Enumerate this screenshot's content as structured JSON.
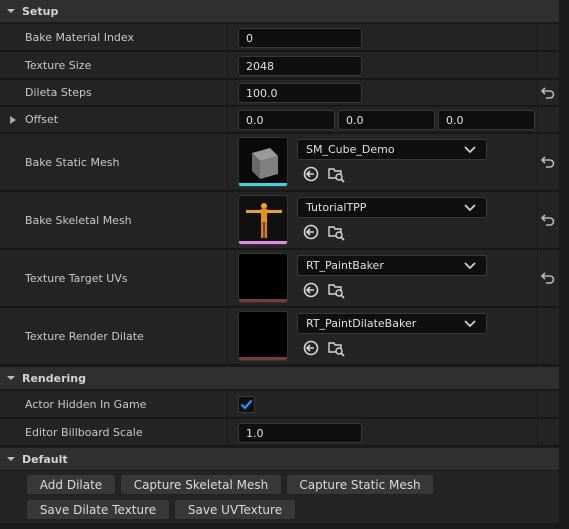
{
  "sections": {
    "setup": "Setup",
    "rendering": "Rendering",
    "default": "Default"
  },
  "setup": {
    "bake_material_index": {
      "label": "Bake Material Index",
      "value": "0"
    },
    "texture_size": {
      "label": "Texture Size",
      "value": "2048"
    },
    "dileta_steps": {
      "label": "Dileta Steps",
      "value": "100.0"
    },
    "offset": {
      "label": "Offset",
      "x": "0.0",
      "y": "0.0",
      "z": "0.0"
    },
    "bake_static_mesh": {
      "label": "Bake Static Mesh",
      "asset": "SM_Cube_Demo"
    },
    "bake_skeletal_mesh": {
      "label": "Bake Skeletal Mesh",
      "asset": "TutorialTPP"
    },
    "texture_target_uvs": {
      "label": "Texture Target UVs",
      "asset": "RT_PaintBaker"
    },
    "texture_render_dilate": {
      "label": "Texture Render Dilate",
      "asset": "RT_PaintDilateBaker"
    }
  },
  "rendering": {
    "actor_hidden_in_game": {
      "label": "Actor Hidden In Game",
      "checked": true
    },
    "editor_billboard_scale": {
      "label": "Editor Billboard Scale",
      "value": "1.0"
    }
  },
  "default": {
    "buttons": [
      "Add Dilate",
      "Capture Skeletal Mesh",
      "Capture Static Mesh",
      "Save Dilate Texture",
      "Save UVTexture"
    ]
  },
  "colors": {
    "static_mesh_bar": "#3fd6e0",
    "skeletal_mesh_bar": "#e08ae8",
    "render_target_bar": "#7a3a3a",
    "checkbox_check": "#2f8fff"
  },
  "icons": {
    "use_selected": "arrow-left-circle-icon",
    "browse": "browse-folder-search-icon",
    "reset": "reset-arrow-icon",
    "caret": "chevron-down-icon"
  }
}
